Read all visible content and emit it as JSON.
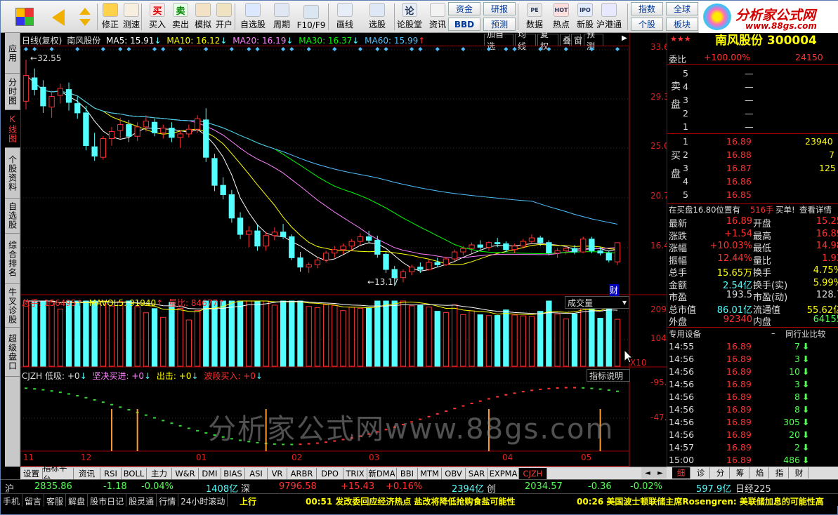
{
  "toolbar": {
    "buttons": [
      {
        "label": "修正",
        "icon": "pencil-icon"
      },
      {
        "label": "测速",
        "icon": "clock-icon"
      },
      {
        "label": "买入",
        "icon": "buy-icon",
        "glyph": "买"
      },
      {
        "label": "卖出",
        "icon": "sell-icon",
        "glyph": "卖"
      },
      {
        "label": "模拟",
        "icon": "hammer-icon"
      },
      {
        "label": "开户",
        "icon": "lock-icon"
      },
      {
        "label": "自选股",
        "icon": "star-folder-icon"
      },
      {
        "label": "周期",
        "icon": "clock-icon"
      },
      {
        "label": "F10/F9",
        "icon": "f10-icon"
      },
      {
        "label": "画线",
        "icon": "pen-icon"
      },
      {
        "label": "选股",
        "icon": "screen-icon"
      },
      {
        "label": "论股堂",
        "icon": "forum-icon",
        "glyph": "论"
      },
      {
        "label": "资讯",
        "icon": "info-icon"
      },
      {
        "label": "数据",
        "icon": "pe-icon",
        "glyph": "PE"
      },
      {
        "label": "热点",
        "icon": "hot-icon",
        "glyph": "HOT"
      },
      {
        "label": "新股",
        "icon": "ipo-icon",
        "glyph": "IPO"
      },
      {
        "label": "沪港通",
        "icon": "sse-hkex-icon"
      }
    ],
    "small_buttons": [
      "资金",
      "研报",
      "BBD",
      "预测",
      "指数",
      "全球",
      "个股",
      "板块"
    ]
  },
  "logo": {
    "title": "分析家公式网",
    "url_text": "www.88gs.com"
  },
  "left_tabs": [
    "应用",
    "分时图",
    "K线图",
    "个股资料",
    "自选股",
    "综合排名",
    "牛叉诊股",
    "超级盘口"
  ],
  "chart_header": {
    "period": "日线(复权)",
    "stock": "南风股份",
    "ma5": "MA5: 15.91",
    "ma10": "MA10: 16.12",
    "ma20": "MA20: 16.19",
    "ma30": "MA30: 16.37",
    "ma60": "MA60: 15.99",
    "buttons": [
      "加自选",
      "均线",
      "复权",
      "叠",
      "窗",
      "预测"
    ]
  },
  "price_axis": [
    "33.63",
    "29.36",
    "25.03",
    "20.76",
    "16.42"
  ],
  "annotations": {
    "high": "32.55",
    "low": "13.17",
    "fin_badge": "财"
  },
  "volume_header": {
    "total": "总手: 156495",
    "mavol5": "MAVOL5: 91940",
    "ratio": "量比: 84677",
    "dropdown": "成交量",
    "axis": [
      "20984",
      "10492"
    ],
    "unit": "X10"
  },
  "indicator_header": {
    "name": "CJZH",
    "low": "低吸: +0",
    "buy": "坚决买进: +0",
    "sell": "出击: +0",
    "wave": "波段买入: +0",
    "help": "指标说明",
    "axis": [
      "95.00",
      "47.96"
    ]
  },
  "month_labels": [
    "11",
    "12",
    "01",
    "02",
    "03",
    "04",
    "05"
  ],
  "watermark": "分析家公式网www.88gs.com",
  "bottom_tabs": [
    "设置",
    "指标平台",
    "资讯",
    "RSI",
    "BOLL",
    "主力",
    "W&R",
    "DMI",
    "BIAS",
    "ASI",
    "VR",
    "ARBR",
    "DPO",
    "TRIX",
    "新DMA",
    "BBI",
    "MTM",
    "OBV",
    "SAR",
    "EXPMA",
    "CJZH"
  ],
  "right_panel": {
    "title": "南风股份 300004",
    "weibi_label": "委比",
    "weibi_value": "+100.00%",
    "weibi_diff": "24150",
    "sell_label": "卖盘",
    "buy_label": "买盘",
    "asks": [
      {
        "n": "5",
        "p": "—",
        "v": ""
      },
      {
        "n": "4",
        "p": "—",
        "v": ""
      },
      {
        "n": "3",
        "p": "—",
        "v": ""
      },
      {
        "n": "2",
        "p": "—",
        "v": ""
      },
      {
        "n": "1",
        "p": "—",
        "v": ""
      }
    ],
    "bids": [
      {
        "n": "1",
        "p": "16.89",
        "v": "23940"
      },
      {
        "n": "2",
        "p": "16.88",
        "v": "7"
      },
      {
        "n": "3",
        "p": "16.87",
        "v": "125"
      },
      {
        "n": "4",
        "p": "16.86",
        "v": ""
      },
      {
        "n": "5",
        "p": "16.85",
        "v": ""
      }
    ],
    "notice": "在买盘16.80位置有",
    "notice_vol": "516手",
    "notice_tail": "买单!",
    "notice_link": "查看详情",
    "stats": [
      [
        "最新",
        "16.89",
        "开盘",
        "15.25"
      ],
      [
        "涨跌",
        "+1.54",
        "最高",
        "16.89"
      ],
      [
        "涨幅",
        "+10.03%",
        "最低",
        "14.98"
      ],
      [
        "振幅",
        "12.44%",
        "量比",
        "1.93"
      ],
      [
        "总手",
        "15.65万",
        "换手",
        "4.75%"
      ],
      [
        "金额",
        "2.54亿",
        "换手(实)",
        "5.99%"
      ],
      [
        "市盈",
        "193.5",
        "市盈(动)",
        "128.7"
      ],
      [
        "总市值",
        "86.01亿",
        "流通值",
        "55.62亿"
      ],
      [
        "外盘",
        "92340",
        "内盘",
        "64155"
      ]
    ],
    "sub_header_left": "专用设备",
    "sub_header_right": "同行业比较",
    "ticks": [
      [
        "14:55",
        "16.89",
        "7"
      ],
      [
        "14:56",
        "16.89",
        "3"
      ],
      [
        "14:56",
        "16.89",
        "10"
      ],
      [
        "14:56",
        "16.89",
        "3"
      ],
      [
        "14:56",
        "16.89",
        "8"
      ],
      [
        "14:56",
        "16.89",
        "8"
      ],
      [
        "14:56",
        "16.89",
        "305"
      ],
      [
        "14:56",
        "16.89",
        "20"
      ],
      [
        "14:57",
        "16.89",
        "2"
      ],
      [
        "15:00",
        "16.89",
        "486"
      ]
    ],
    "tabs": [
      "细",
      "诊",
      "分",
      "筹",
      "焰",
      "指",
      "财"
    ]
  },
  "statusbar": {
    "sh_label": "沪",
    "sh_index": "2835.86",
    "sh_change": "-1.18",
    "sh_pct": "-0.04%",
    "sh_amount": "1408亿",
    "sz_label": "深",
    "sz_index": "9796.58",
    "sz_change": "+15.43",
    "sz_pct": "+0.16%",
    "sz_amount": "2394亿",
    "cy_label": "创",
    "cy_index": "2034.57",
    "cy_change": "-0.36",
    "cy_pct": "-0.02%",
    "cy_amount": "597.9亿",
    "rz_label": "日经225"
  },
  "ticker": {
    "buttons": [
      "手机",
      "留言",
      "客服",
      "解盘",
      "股市日记",
      "股灵通",
      "行情",
      "24小时滚动"
    ],
    "news1": "00:51 发改委回应经济热点 盐改将降低抢购食盐可能性",
    "news2": "00:26 美国波士顿联储主席Rosengren: 美联储加息的可能性高"
  },
  "colors": {
    "up": "#ff3232",
    "down": "#54ffff",
    "ma5": "#ffffff",
    "ma10": "#ffff00",
    "ma20": "#ff80ff",
    "ma30": "#00ff00",
    "ma60": "#4fc0ff",
    "grid": "#a00000"
  },
  "chart_data": {
    "type": "candlestick",
    "title": "南风股份 日线(复权)",
    "x_months": [
      "11",
      "12",
      "01",
      "02",
      "03",
      "04",
      "05"
    ],
    "price_range": [
      12.5,
      34.0
    ],
    "ohlc_sample": [
      {
        "o": 29.0,
        "h": 32.55,
        "l": 28.3,
        "c": 31.2
      },
      {
        "o": 31.0,
        "h": 31.8,
        "l": 29.5,
        "c": 30.0
      },
      {
        "o": 30.2,
        "h": 30.8,
        "l": 28.0,
        "c": 28.6
      },
      {
        "o": 28.5,
        "h": 29.9,
        "l": 27.6,
        "c": 29.4
      },
      {
        "o": 29.5,
        "h": 30.5,
        "l": 28.8,
        "c": 30.1
      },
      {
        "o": 30.0,
        "h": 30.6,
        "l": 28.2,
        "c": 28.9
      },
      {
        "o": 28.8,
        "h": 29.4,
        "l": 27.5,
        "c": 28.0
      },
      {
        "o": 28.0,
        "h": 28.6,
        "l": 24.8,
        "c": 25.2
      },
      {
        "o": 25.1,
        "h": 26.3,
        "l": 23.9,
        "c": 24.3
      },
      {
        "o": 24.2,
        "h": 26.0,
        "l": 24.0,
        "c": 25.8
      },
      {
        "o": 25.8,
        "h": 26.8,
        "l": 25.2,
        "c": 26.4
      },
      {
        "o": 26.5,
        "h": 27.6,
        "l": 25.8,
        "c": 27.0
      },
      {
        "o": 27.0,
        "h": 27.4,
        "l": 25.5,
        "c": 26.0
      },
      {
        "o": 26.0,
        "h": 27.2,
        "l": 25.6,
        "c": 26.8
      },
      {
        "o": 26.8,
        "h": 27.8,
        "l": 26.4,
        "c": 27.3
      },
      {
        "o": 27.2,
        "h": 27.5,
        "l": 26.0,
        "c": 26.3
      },
      {
        "o": 26.3,
        "h": 27.0,
        "l": 25.8,
        "c": 26.7
      },
      {
        "o": 26.7,
        "h": 27.2,
        "l": 25.5,
        "c": 25.9
      },
      {
        "o": 25.9,
        "h": 26.5,
        "l": 25.0,
        "c": 26.2
      },
      {
        "o": 26.2,
        "h": 27.0,
        "l": 25.9,
        "c": 26.6
      },
      {
        "o": 26.6,
        "h": 27.8,
        "l": 26.3,
        "c": 27.5
      },
      {
        "o": 27.4,
        "h": 28.4,
        "l": 23.8,
        "c": 24.2
      },
      {
        "o": 24.1,
        "h": 24.5,
        "l": 21.3,
        "c": 21.8
      },
      {
        "o": 21.8,
        "h": 22.5,
        "l": 20.6,
        "c": 21.0
      },
      {
        "o": 21.0,
        "h": 21.4,
        "l": 18.6,
        "c": 19.0
      },
      {
        "o": 19.0,
        "h": 19.5,
        "l": 17.2,
        "c": 17.6
      },
      {
        "o": 17.6,
        "h": 18.3,
        "l": 16.5,
        "c": 17.9
      },
      {
        "o": 17.9,
        "h": 18.4,
        "l": 16.2,
        "c": 16.6
      },
      {
        "o": 16.6,
        "h": 17.8,
        "l": 16.2,
        "c": 17.5
      },
      {
        "o": 17.5,
        "h": 18.2,
        "l": 17.1,
        "c": 17.8
      },
      {
        "o": 17.8,
        "h": 18.5,
        "l": 17.2,
        "c": 17.4
      },
      {
        "o": 17.4,
        "h": 17.6,
        "l": 15.4,
        "c": 15.6
      },
      {
        "o": 15.6,
        "h": 16.1,
        "l": 14.4,
        "c": 14.8
      },
      {
        "o": 14.8,
        "h": 15.2,
        "l": 14.3,
        "c": 15.0
      },
      {
        "o": 15.0,
        "h": 15.6,
        "l": 14.7,
        "c": 15.4
      },
      {
        "o": 15.4,
        "h": 16.2,
        "l": 15.2,
        "c": 16.0
      },
      {
        "o": 16.0,
        "h": 16.6,
        "l": 15.6,
        "c": 16.3
      },
      {
        "o": 16.3,
        "h": 16.8,
        "l": 15.9,
        "c": 16.6
      },
      {
        "o": 16.6,
        "h": 17.2,
        "l": 16.2,
        "c": 17.0
      },
      {
        "o": 17.0,
        "h": 17.7,
        "l": 16.7,
        "c": 17.4
      },
      {
        "o": 17.4,
        "h": 17.9,
        "l": 16.9,
        "c": 17.1
      },
      {
        "o": 17.1,
        "h": 17.5,
        "l": 15.6,
        "c": 15.9
      },
      {
        "o": 15.9,
        "h": 16.1,
        "l": 14.3,
        "c": 14.6
      },
      {
        "o": 14.6,
        "h": 14.9,
        "l": 13.17,
        "c": 13.9
      },
      {
        "o": 13.9,
        "h": 14.6,
        "l": 13.5,
        "c": 14.4
      },
      {
        "o": 14.4,
        "h": 15.0,
        "l": 14.1,
        "c": 14.8
      },
      {
        "o": 14.8,
        "h": 15.2,
        "l": 14.3,
        "c": 14.6
      },
      {
        "o": 14.6,
        "h": 15.4,
        "l": 14.5,
        "c": 15.2
      },
      {
        "o": 15.2,
        "h": 15.6,
        "l": 14.8,
        "c": 15.0
      },
      {
        "o": 15.0,
        "h": 15.7,
        "l": 14.9,
        "c": 15.5
      },
      {
        "o": 15.5,
        "h": 16.3,
        "l": 15.3,
        "c": 16.1
      },
      {
        "o": 16.1,
        "h": 16.6,
        "l": 15.8,
        "c": 16.4
      },
      {
        "o": 16.4,
        "h": 16.9,
        "l": 16.0,
        "c": 16.7
      },
      {
        "o": 16.7,
        "h": 17.1,
        "l": 16.3,
        "c": 16.5
      },
      {
        "o": 16.5,
        "h": 17.0,
        "l": 16.2,
        "c": 16.9
      },
      {
        "o": 16.9,
        "h": 17.3,
        "l": 16.5,
        "c": 16.8
      },
      {
        "o": 16.8,
        "h": 17.0,
        "l": 16.1,
        "c": 16.3
      },
      {
        "o": 16.3,
        "h": 16.8,
        "l": 16.0,
        "c": 16.6
      },
      {
        "o": 16.6,
        "h": 17.2,
        "l": 16.4,
        "c": 17.0
      },
      {
        "o": 17.0,
        "h": 17.6,
        "l": 16.8,
        "c": 17.3
      },
      {
        "o": 17.3,
        "h": 17.5,
        "l": 16.6,
        "c": 16.9
      },
      {
        "o": 16.9,
        "h": 17.1,
        "l": 15.8,
        "c": 16.0
      },
      {
        "o": 16.0,
        "h": 16.4,
        "l": 15.6,
        "c": 16.2
      },
      {
        "o": 16.2,
        "h": 16.6,
        "l": 15.9,
        "c": 16.4
      },
      {
        "o": 16.4,
        "h": 16.7,
        "l": 15.9,
        "c": 16.1
      },
      {
        "o": 16.1,
        "h": 17.4,
        "l": 16.0,
        "c": 17.2
      },
      {
        "o": 17.2,
        "h": 17.4,
        "l": 16.0,
        "c": 16.2
      },
      {
        "o": 16.2,
        "h": 16.5,
        "l": 15.8,
        "c": 16.0
      },
      {
        "o": 16.0,
        "h": 16.2,
        "l": 15.2,
        "c": 15.4
      },
      {
        "o": 15.25,
        "h": 16.89,
        "l": 14.98,
        "c": 16.89
      }
    ]
  }
}
